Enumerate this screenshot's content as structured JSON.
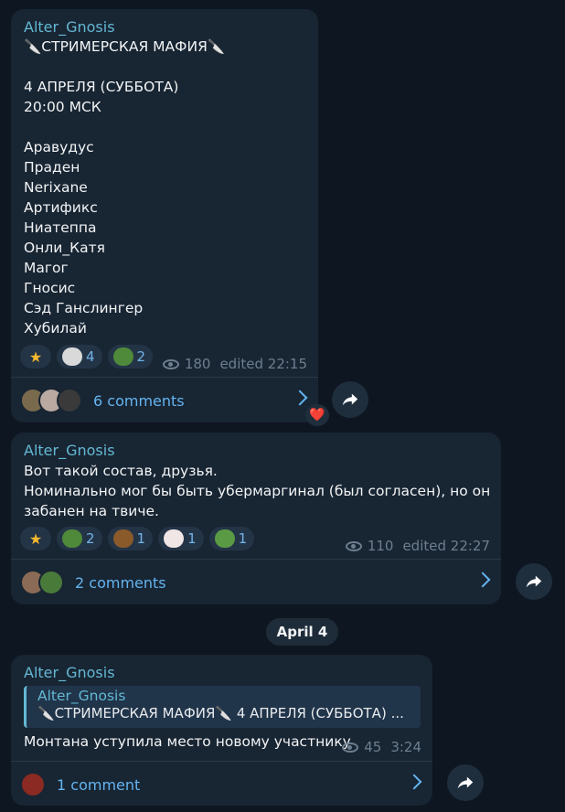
{
  "messages": [
    {
      "author": "Alter_Gnosis",
      "lines": [
        "🔪СТРИМЕРСКАЯ МАФИЯ🔪",
        "",
        "4 АПРЕЛЯ (СУББОТА)",
        "20:00 МСК",
        "",
        "Аравудус",
        "Праден",
        "Nerixane",
        "Артификс",
        "Ниатеппа",
        "Онли_Катя",
        "Магог",
        "Гносис",
        "Сэд Ганслингер",
        "Хубилай"
      ],
      "reactions": [
        {
          "icon": "star-icon",
          "count": ""
        },
        {
          "icon": "cat-emoji-icon",
          "count": "4"
        },
        {
          "icon": "pepe-question-icon",
          "count": "2"
        }
      ],
      "views": "180",
      "time": "edited 22:15",
      "comments": "6 comments"
    },
    {
      "author": "Alter_Gnosis",
      "lines": [
        "Вот такой состав, друзья.",
        "Номинально мог бы быть убермаргинал (был согласен), но он",
        "забанен на твиче."
      ],
      "reactions": [
        {
          "icon": "star-icon",
          "count": ""
        },
        {
          "icon": "pepe-icon",
          "count": "2"
        },
        {
          "icon": "poop-icon",
          "count": "1"
        },
        {
          "icon": "clown-icon",
          "count": "1"
        },
        {
          "icon": "pepe-clown-icon",
          "count": "1"
        }
      ],
      "views": "110",
      "time": "edited 22:27",
      "comments": "2 comments"
    },
    {
      "author": "Alter_Gnosis",
      "quote_author": "Alter_Gnosis",
      "quote_text": "🔪СТРИМЕРСКАЯ МАФИЯ🔪 4 АПРЕЛЯ (СУББОТА) ...",
      "text": "Монтана уступила место новому участнику",
      "views": "45",
      "time": "3:24",
      "comments": "1 comment"
    }
  ],
  "date_separator": "April 4",
  "heart_reaction": "❤️",
  "colors": {
    "bg": "#0e1621",
    "bubble": "#182533",
    "author": "#64b8d3",
    "link": "#64b4f0"
  }
}
